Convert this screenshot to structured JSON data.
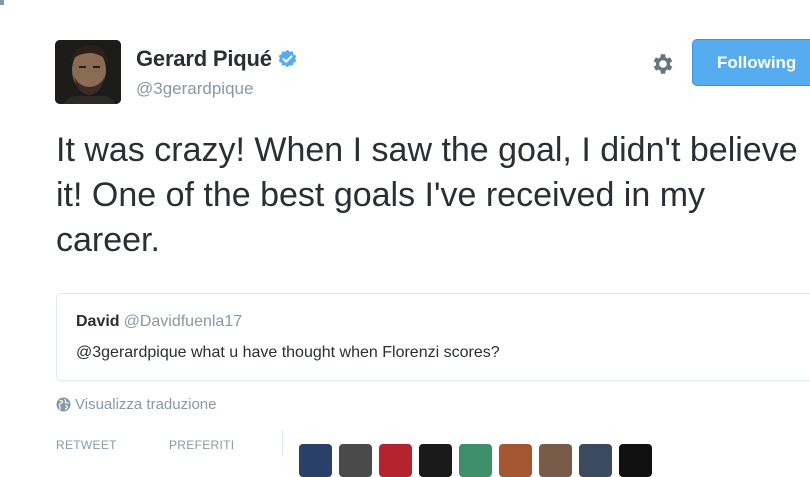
{
  "tweet": {
    "author": {
      "name": "Gerard Piqué",
      "handle": "@3gerardpique",
      "verified": true,
      "avatar_icon": "profile-photo"
    },
    "follow_button_label": "Following",
    "settings_icon": "gear-icon",
    "text": "It was crazy! When I saw the goal, I didn't believe it! One of the best goals I've received in my career.",
    "quoted": {
      "name": "David",
      "handle": "@Davidfuenla17",
      "text": "@3gerardpique what u have thought when Florenzi scores?"
    },
    "translate_label": "Visualizza traduzione",
    "stats": {
      "retweet_label": "RETWEET",
      "favorites_label": "PREFERITI"
    }
  },
  "colors": {
    "accent": "#55acee",
    "text": "#292f33",
    "muted": "#8899a6",
    "border": "#e1e8ed",
    "favorite_avatars": [
      "#2b3f6b",
      "#4a4a4a",
      "#b5242e",
      "#1a1a1a",
      "#3d8f6a",
      "#a3562f",
      "#7a5a48",
      "#3b4a5e",
      "#111111"
    ]
  }
}
